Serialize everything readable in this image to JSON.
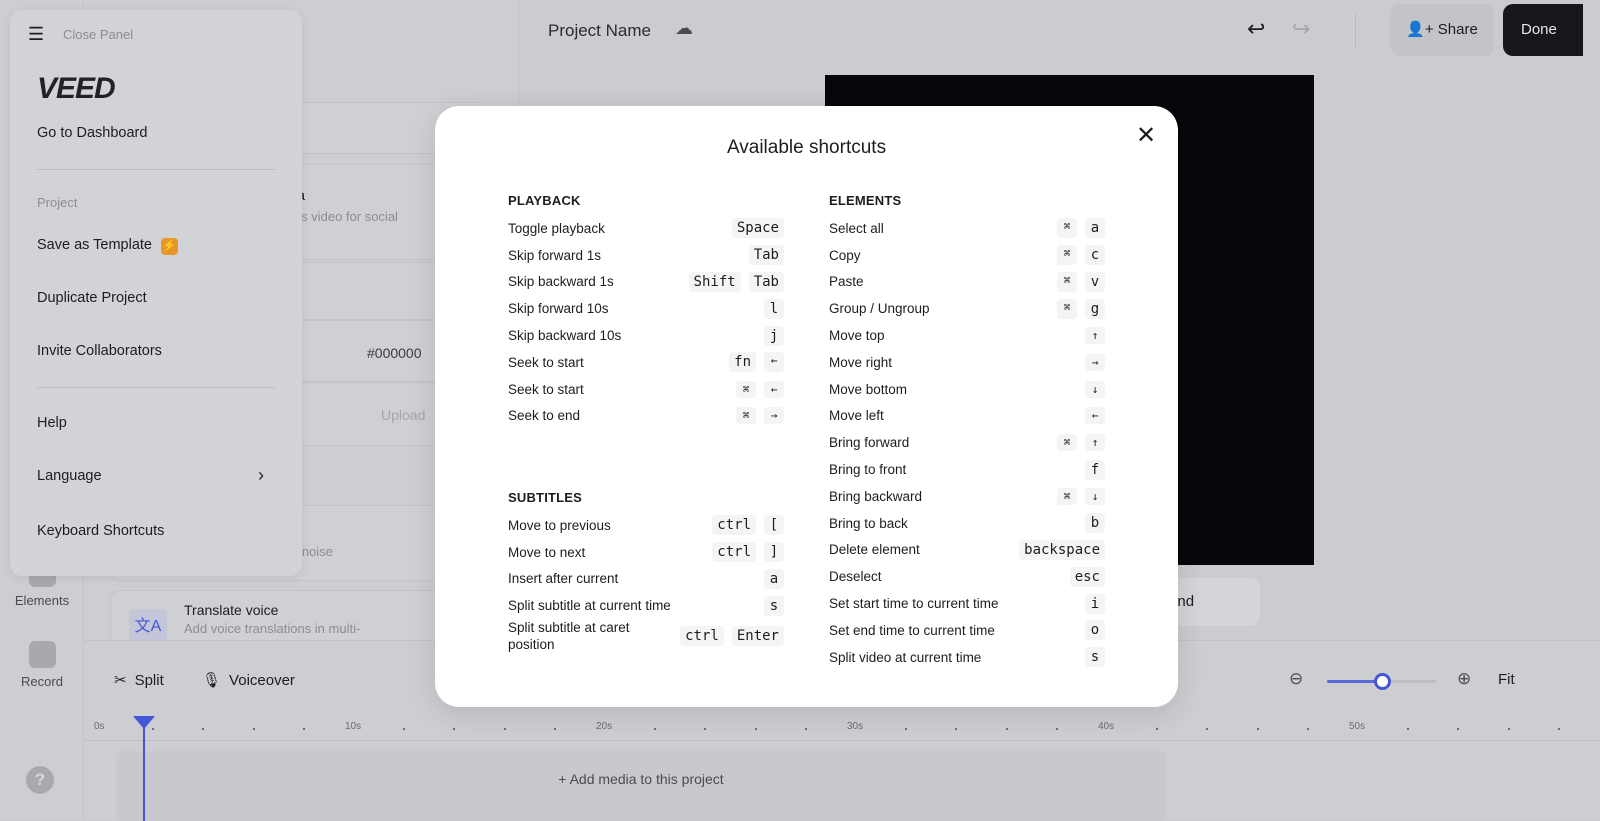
{
  "rail": {
    "items": [
      {
        "label": "Elements"
      },
      {
        "label": "Record"
      }
    ],
    "help": "?"
  },
  "side": {
    "card1_title_fragment": "lia",
    "card1_sub_fragment": "his video for social",
    "color_value": "#000000",
    "upload": "Upload",
    "noise_fragment": "d noise",
    "translate_title": "Translate voice",
    "translate_sub": "Add voice translations in multi-"
  },
  "header": {
    "project_name": "Project Name",
    "share": "Share",
    "done": "Done"
  },
  "canvas": {
    "background_btn": "Background"
  },
  "timeline": {
    "split": "Split",
    "voiceover": "Voiceover",
    "fit": "Fit",
    "zoom_level": 0.5,
    "ticks": [
      "0s",
      "10s",
      "20s",
      "30s",
      "40s",
      "50s"
    ],
    "add_media": "Add media to this project"
  },
  "menu": {
    "close": "Close Panel",
    "logo": "VEED",
    "dashboard": "Go to Dashboard",
    "section": "Project",
    "items": [
      "Save as Template",
      "Duplicate Project",
      "Invite Collaborators"
    ],
    "help": "Help",
    "language": "Language",
    "shortcuts": "Keyboard Shortcuts",
    "badge_color": "#e8962a"
  },
  "modal": {
    "title": "Available shortcuts",
    "sections": [
      {
        "title": "PLAYBACK",
        "rows": [
          {
            "label": "Toggle playback",
            "keys": [
              "Space"
            ]
          },
          {
            "label": "Skip forward 1s",
            "keys": [
              "Tab"
            ]
          },
          {
            "label": "Skip backward 1s",
            "keys": [
              "Shift",
              "Tab"
            ]
          },
          {
            "label": "Skip forward 10s",
            "keys": [
              "l"
            ]
          },
          {
            "label": "Skip backward 10s",
            "keys": [
              "j"
            ]
          },
          {
            "label": "Seek to start",
            "keys": [
              "fn",
              "←"
            ]
          },
          {
            "label": "Seek to start",
            "keys": [
              "⌘",
              "←"
            ]
          },
          {
            "label": "Seek to end",
            "keys": [
              "⌘",
              "→"
            ]
          }
        ]
      },
      {
        "title": "SUBTITLES",
        "rows": [
          {
            "label": "Move to previous",
            "keys": [
              "ctrl",
              "["
            ]
          },
          {
            "label": "Move to next",
            "keys": [
              "ctrl",
              "]"
            ]
          },
          {
            "label": "Insert after current",
            "keys": [
              "a"
            ]
          },
          {
            "label": "Split subtitle at current time",
            "keys": [
              "s"
            ]
          },
          {
            "label": "Split subtitle at caret position",
            "keys": [
              "ctrl",
              "Enter"
            ]
          }
        ]
      },
      {
        "title": "ELEMENTS",
        "rows": [
          {
            "label": "Select all",
            "keys": [
              "⌘",
              "a"
            ]
          },
          {
            "label": "Copy",
            "keys": [
              "⌘",
              "c"
            ]
          },
          {
            "label": "Paste",
            "keys": [
              "⌘",
              "v"
            ]
          },
          {
            "label": "Group / Ungroup",
            "keys": [
              "⌘",
              "g"
            ]
          },
          {
            "label": "Move top",
            "keys": [
              "↑"
            ]
          },
          {
            "label": "Move right",
            "keys": [
              "→"
            ]
          },
          {
            "label": "Move bottom",
            "keys": [
              "↓"
            ]
          },
          {
            "label": "Move left",
            "keys": [
              "←"
            ]
          },
          {
            "label": "Bring forward",
            "keys": [
              "⌘",
              "↑"
            ]
          },
          {
            "label": "Bring to front",
            "keys": [
              "f"
            ]
          },
          {
            "label": "Bring backward",
            "keys": [
              "⌘",
              "↓"
            ]
          },
          {
            "label": "Bring to back",
            "keys": [
              "b"
            ]
          },
          {
            "label": "Delete element",
            "keys": [
              "backspace"
            ]
          },
          {
            "label": "Deselect",
            "keys": [
              "esc"
            ]
          },
          {
            "label": "Set start time to current time",
            "keys": [
              "i"
            ]
          },
          {
            "label": "Set end time to current time",
            "keys": [
              "o"
            ]
          },
          {
            "label": "Split video at current time",
            "keys": [
              "s"
            ]
          }
        ]
      }
    ]
  }
}
